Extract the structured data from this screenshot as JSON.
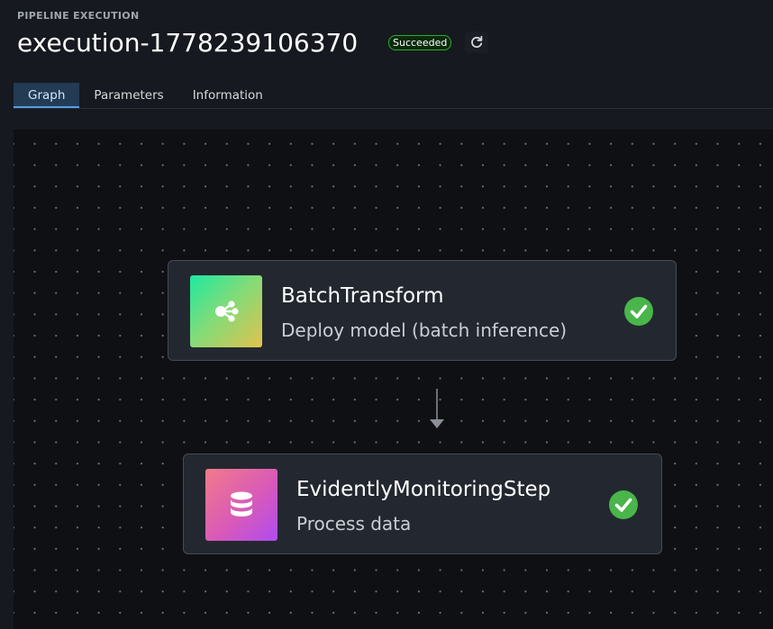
{
  "header": {
    "eyebrow": "PIPELINE EXECUTION",
    "execution_name": "execution-1778239106370",
    "status": "Succeeded",
    "status_color": "#29ad32",
    "refresh_icon": "refresh-icon"
  },
  "tabs": [
    {
      "label": "Graph",
      "active": true
    },
    {
      "label": "Parameters",
      "active": false
    },
    {
      "label": "Information",
      "active": false
    }
  ],
  "graph": {
    "nodes": [
      {
        "title": "BatchTransform",
        "subtitle": "Deploy model (batch inference)",
        "icon": "share-nodes-icon",
        "icon_colors": [
          "#1ee9a0",
          "#e2c24d"
        ],
        "status_icon": "check-circle-icon",
        "status_color": "#49b54a"
      },
      {
        "title": "EvidentlyMonitoringStep",
        "subtitle": "Process data",
        "icon": "database-icon",
        "icon_colors": [
          "#f37a8a",
          "#b04bf0"
        ],
        "status_icon": "check-circle-icon",
        "status_color": "#49b54a"
      }
    ],
    "edges": [
      {
        "from": "BatchTransform",
        "to": "EvidentlyMonitoringStep"
      }
    ]
  }
}
